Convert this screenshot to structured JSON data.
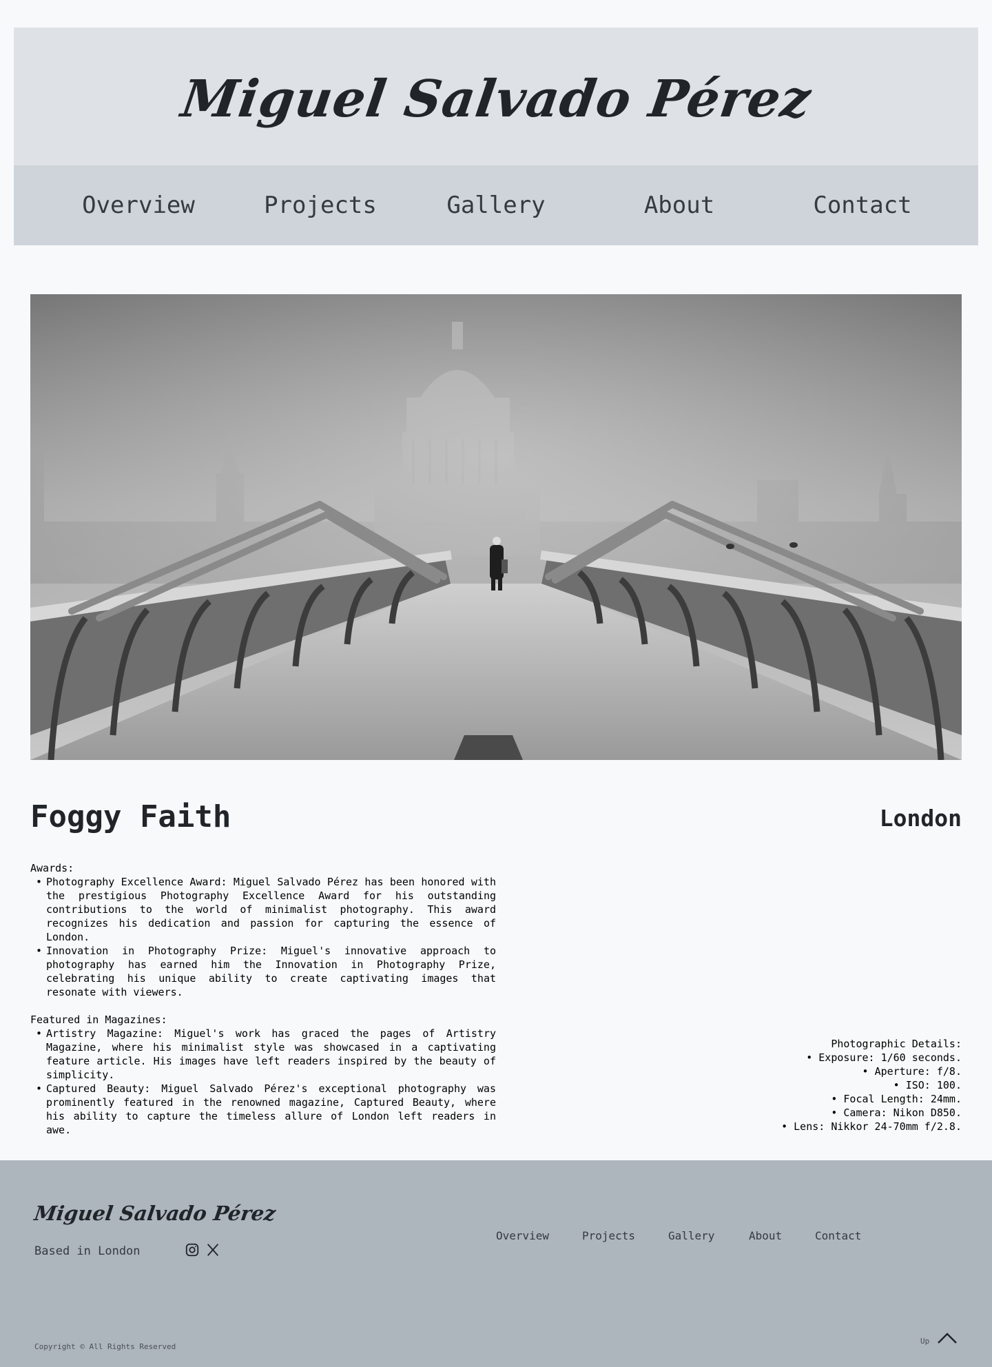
{
  "header": {
    "title": "Miguel Salvado Pérez"
  },
  "nav": {
    "items": [
      "Overview",
      "Projects",
      "Gallery",
      "About",
      "Contact"
    ]
  },
  "photo": {
    "title": "Foggy Faith",
    "location": "London",
    "awards_heading": "Awards:",
    "awards": [
      "Photography Excellence Award: Miguel Salvado Pérez has been honored with the prestigious Photography Excellence Award for his outstanding contributions to the world of minimalist photography. This award recognizes his dedication and passion for capturing the essence of London.",
      "Innovation in Photography Prize: Miguel's innovative approach to photography has earned him the Innovation in Photography Prize, celebrating his unique ability to create captivating images that resonate with viewers."
    ],
    "magazines_heading": "Featured in Magazines:",
    "magazines": [
      "Artistry Magazine: Miguel's work has graced the pages of Artistry Magazine, where his minimalist style was showcased in a captivating feature article. His images have left readers inspired by the beauty of simplicity.",
      "Captured Beauty: Miguel Salvado Pérez's exceptional photography was prominently featured in the renowned magazine, Captured Beauty, where his ability to capture the timeless allure of London left readers in awe."
    ],
    "details_heading": "Photographic Details:",
    "details": [
      "Exposure: 1/60 seconds.",
      "Aperture: f/8.",
      "ISO: 100.",
      "Focal Length: 24mm.",
      "Camera: Nikon D850.",
      "Lens: Nikkor 24-70mm f/2.8."
    ]
  },
  "footer": {
    "title": "Miguel Salvado Pérez",
    "location": "Based in London",
    "social_icons": [
      "instagram-icon",
      "x-icon"
    ],
    "nav": [
      "Overview",
      "Projects",
      "Gallery",
      "About",
      "Contact"
    ],
    "copyright": "Copyright © All Rights Reserved",
    "up_label": "Up"
  },
  "colors": {
    "page_bg": "#f8f9fa",
    "header_bg": "#dee2e6",
    "nav_bg": "#ced4da",
    "footer_bg": "#adb5bd",
    "text": "#212529"
  }
}
